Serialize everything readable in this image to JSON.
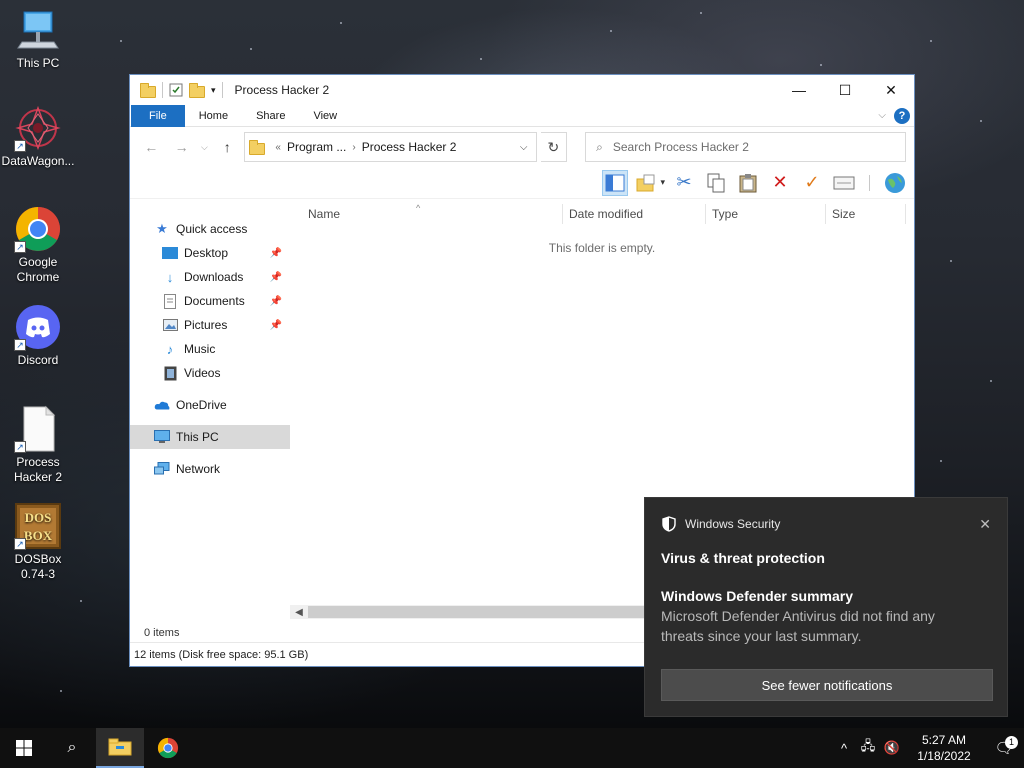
{
  "desktop": {
    "icons": [
      {
        "label": "This PC",
        "icon": "this-pc-icon"
      },
      {
        "label": "DataWagon...",
        "icon": "datawagon-icon"
      },
      {
        "label": "Google Chrome",
        "icon": "chrome-icon"
      },
      {
        "label": "Discord",
        "icon": "discord-icon"
      },
      {
        "label": "Process Hacker 2",
        "icon": "blank-document-icon"
      },
      {
        "label": "DOSBox 0.74-3",
        "icon": "dosbox-icon"
      }
    ],
    "dosbox_logo": "DOS BOX"
  },
  "explorer": {
    "title": "Process Hacker 2",
    "ribbon_tabs": [
      "File",
      "Home",
      "Share",
      "View"
    ],
    "help_label": "?",
    "address": {
      "prefix": "«",
      "crumbs": [
        "Program ...",
        "Process Hacker 2"
      ]
    },
    "search_placeholder": "Search Process Hacker 2",
    "columns": [
      "Name",
      "Date modified",
      "Type",
      "Size"
    ],
    "empty_message": "This folder is empty.",
    "nav": {
      "quick_access": "Quick access",
      "pinned": [
        "Desktop",
        "Downloads",
        "Documents",
        "Pictures"
      ],
      "unpinned": [
        "Music",
        "Videos"
      ],
      "onedrive": "OneDrive",
      "this_pc": "This PC",
      "network": "Network"
    },
    "items_count": "0 items",
    "status": "12 items (Disk free space: 95.1 GB)"
  },
  "toast": {
    "app": "Windows Security",
    "title": "Virus & threat protection",
    "subtitle": "Windows Defender summary",
    "message": "Microsoft Defender Antivirus did not find any threats since your last summary.",
    "button": "See fewer notifications"
  },
  "taskbar": {
    "time": "5:27 AM",
    "date": "1/18/2022",
    "notification_count": "1"
  },
  "colors": {
    "accent": "#1c6fc2",
    "folder": "#f3cf62",
    "toast_bg": "#2b2b2b"
  }
}
